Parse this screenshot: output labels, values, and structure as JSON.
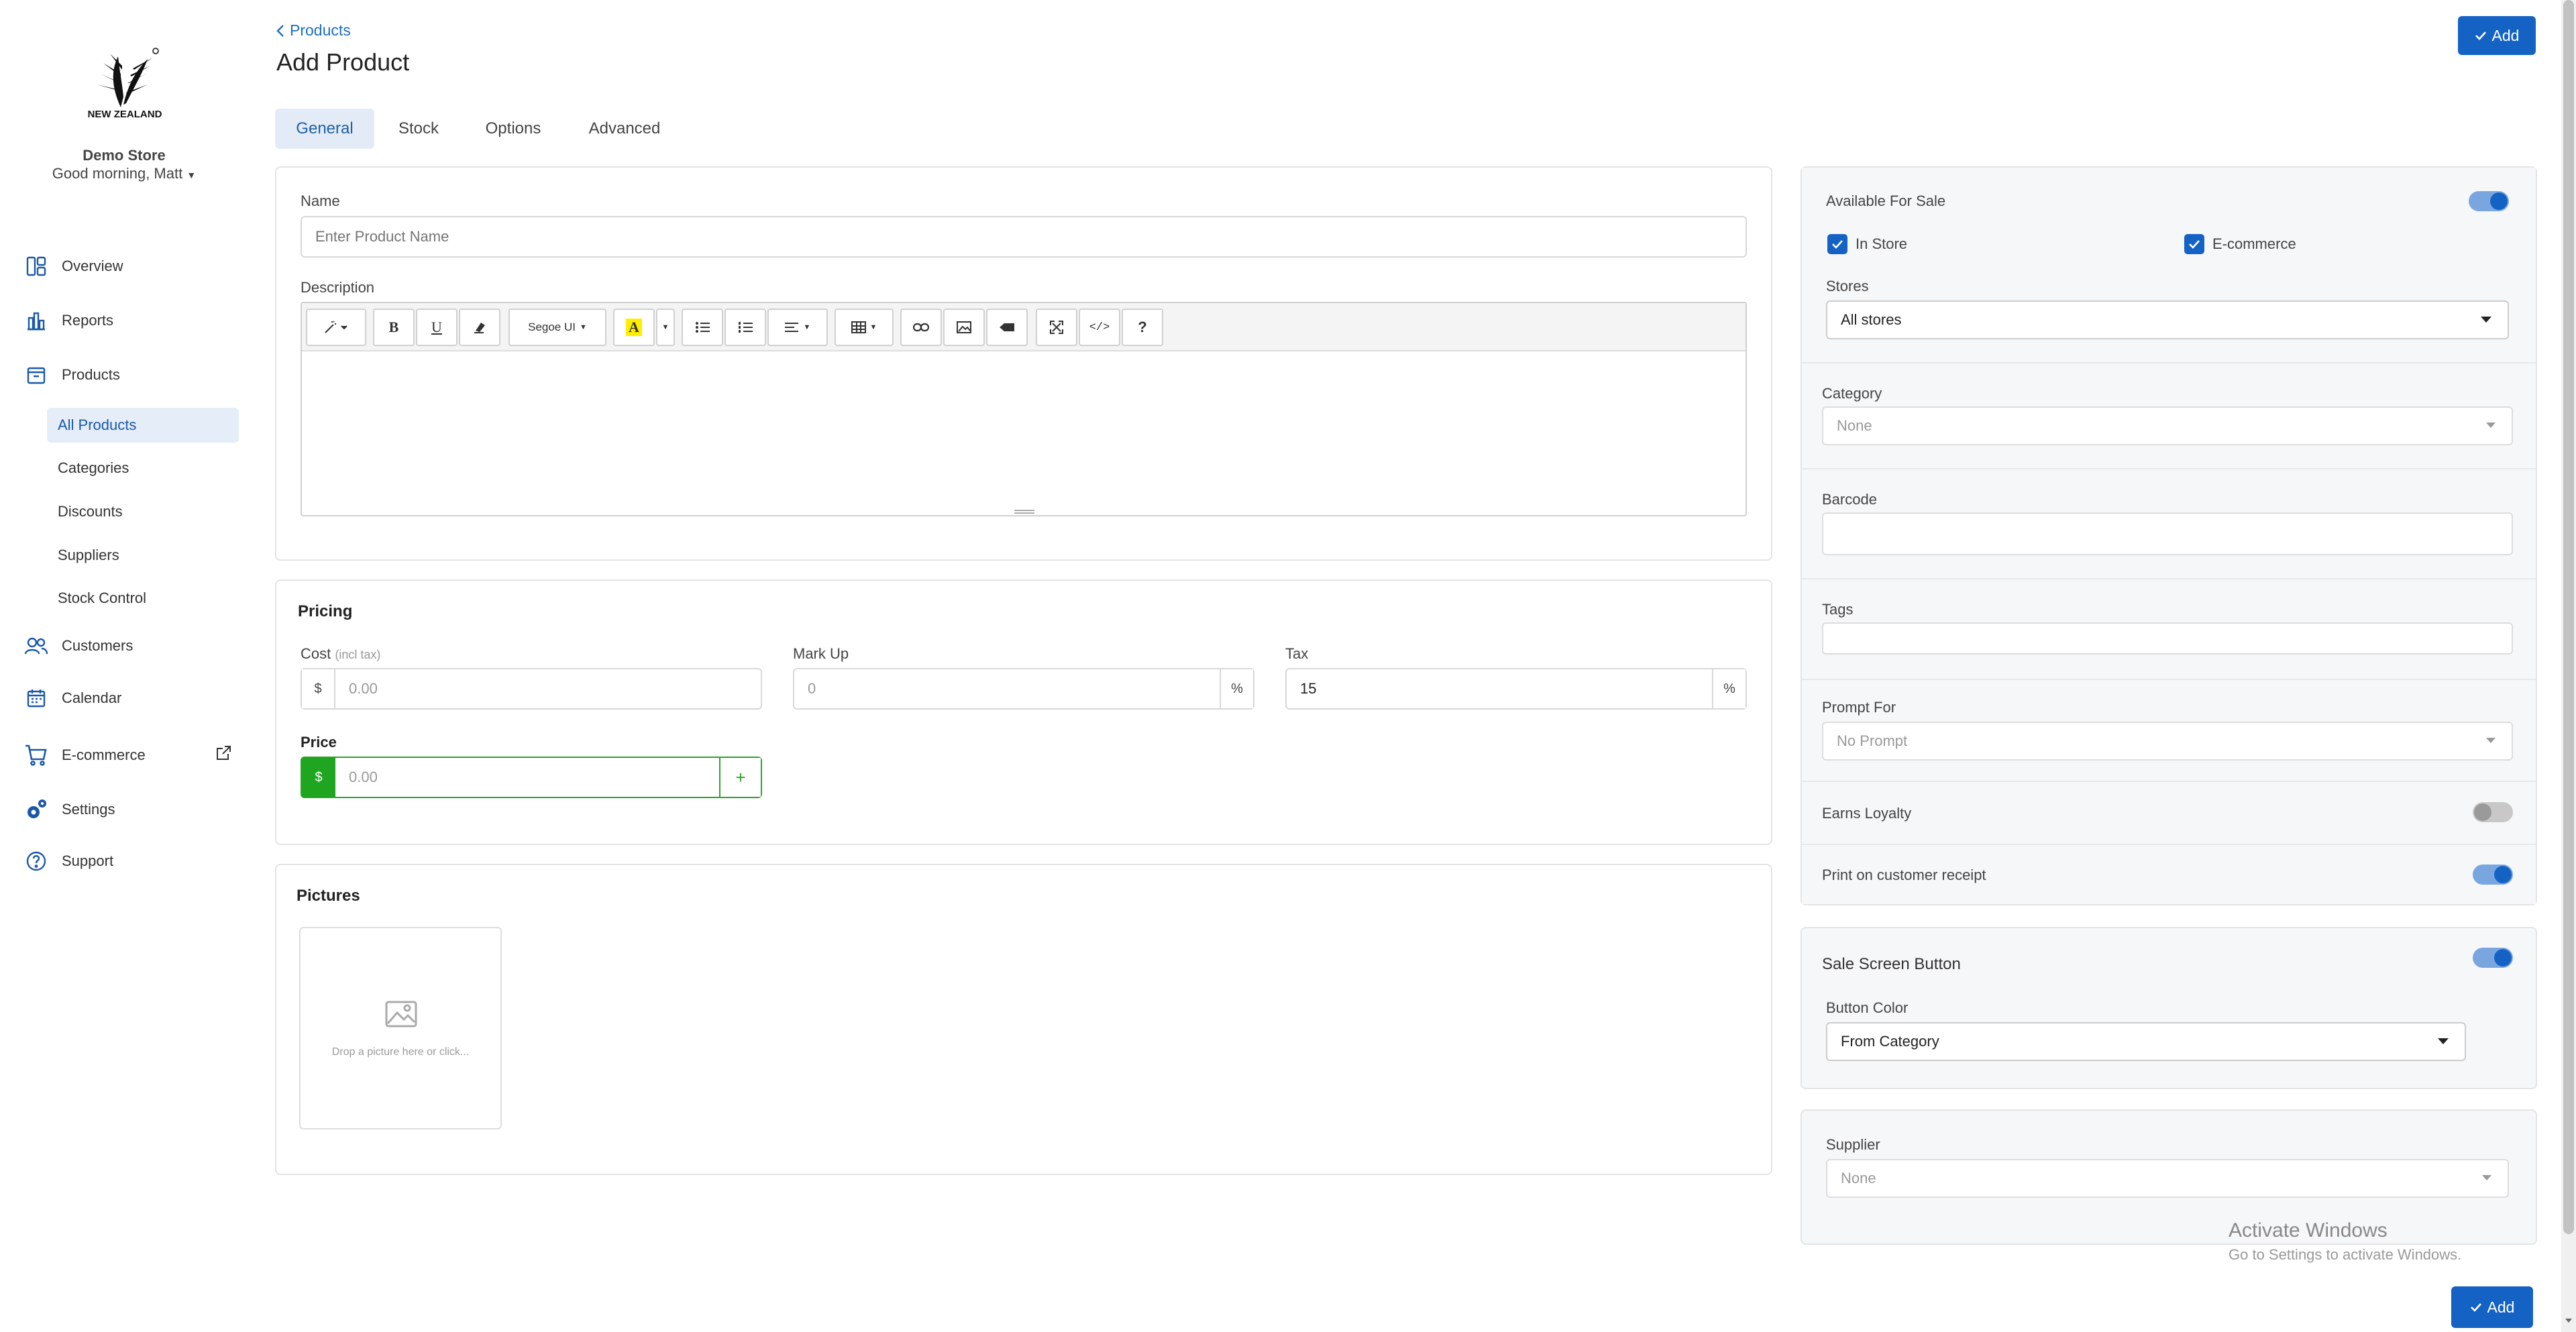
{
  "sidebar": {
    "logo_text": "NEW ZEALAND",
    "store_name": "Demo Store",
    "greeting": "Good morning, Matt",
    "nav": [
      {
        "label": "Overview",
        "icon": "overview-icon"
      },
      {
        "label": "Reports",
        "icon": "bar-chart-icon"
      },
      {
        "label": "Products",
        "icon": "box-icon"
      },
      {
        "label": "Customers",
        "icon": "users-icon"
      },
      {
        "label": "Calendar",
        "icon": "calendar-icon"
      },
      {
        "label": "E-commerce",
        "icon": "cart-icon"
      },
      {
        "label": "Settings",
        "icon": "gear-icon"
      },
      {
        "label": "Support",
        "icon": "help-icon"
      }
    ],
    "products_sub": [
      "All Products",
      "Categories",
      "Discounts",
      "Suppliers",
      "Stock Control"
    ]
  },
  "header": {
    "breadcrumb": "Products",
    "title": "Add Product",
    "add_label": "Add"
  },
  "tabs": [
    "General",
    "Stock",
    "Options",
    "Advanced"
  ],
  "general": {
    "name_label": "Name",
    "name_placeholder": "Enter Product Name",
    "description_label": "Description",
    "font_select": "Segoe UI"
  },
  "pricing": {
    "heading": "Pricing",
    "cost_label": "Cost",
    "cost_note": "(incl tax)",
    "cost_prefix": "$",
    "cost_placeholder": "0.00",
    "markup_label": "Mark Up",
    "markup_placeholder": "0",
    "markup_suffix": "%",
    "tax_label": "Tax",
    "tax_value": "15",
    "tax_suffix": "%",
    "price_label": "Price",
    "price_prefix": "$",
    "price_placeholder": "0.00",
    "price_button": "+"
  },
  "pictures": {
    "heading": "Pictures",
    "drop_text": "Drop a picture here or click..."
  },
  "right": {
    "available_label": "Available For Sale",
    "in_store": "In Store",
    "ecommerce": "E-commerce",
    "stores_label": "Stores",
    "stores_value": "All stores",
    "category_label": "Category",
    "category_value": "None",
    "barcode_label": "Barcode",
    "tags_label": "Tags",
    "prompt_label": "Prompt For",
    "prompt_value": "No Prompt",
    "loyalty_label": "Earns Loyalty",
    "print_label": "Print on customer receipt",
    "sale_button_label": "Sale Screen Button",
    "button_color_label": "Button Color",
    "button_color_value": "From Category",
    "supplier_label": "Supplier",
    "supplier_value": "None"
  },
  "watermark": {
    "line1": "Activate Windows",
    "line2": "Go to Settings to activate Windows."
  },
  "colors": {
    "primary": "#1462c4",
    "price_green": "#1fa51f",
    "active_bg": "#e4edf8"
  }
}
